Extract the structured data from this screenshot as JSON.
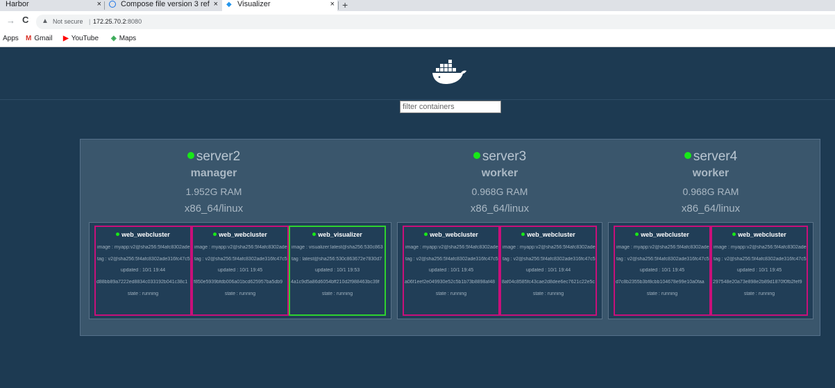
{
  "browser": {
    "tabs": [
      {
        "title": "Harbor",
        "close": "×"
      },
      {
        "title": "Compose file version 3 ref",
        "close": "×"
      },
      {
        "title": "Visualizer",
        "close": "×"
      }
    ],
    "new_tab": "+",
    "security_label": "Not secure",
    "url_host": "172.25.70.2",
    "url_port": ":8080",
    "bookmarks": [
      "Apps",
      "Gmail",
      "YouTube",
      "Maps"
    ]
  },
  "page": {
    "filter_placeholder": "filter containers"
  },
  "nodes": [
    {
      "name": "server2",
      "role": "manager",
      "ram": "1.952G RAM",
      "arch": "x86_64/linux",
      "containers": [
        {
          "name": "web_webcluster",
          "image": "image : myapp:v2@sha256:5f4afc8302ade316fc47c5",
          "tag": "tag : v2@sha256:5f4afc8302ade316fc47c5",
          "updated": "updated : 10/1 19:44",
          "id": "d88bb89a7222ed8834c033192b041c38c1",
          "state": "state : running",
          "kind": "web"
        },
        {
          "name": "web_webcluster",
          "image": "image : myapp:v2@sha256:5f4afc8302ade316fc47c5",
          "tag": "tag : v2@sha256:5f4afc8302ade316fc47c5",
          "updated": "updated : 10/1 19:45",
          "id": "f850e5939bfdb006a01bcd625957ba5db9",
          "state": "state : running",
          "kind": "web"
        },
        {
          "name": "web_visualizer",
          "image": "image : visualizer:latest@sha256:530c863",
          "tag": "tag : latest@sha256:530c863672e7830d7",
          "updated": "updated : 10/1 19:53",
          "id": "4a1c9d5a86d6054bff210d2f988463bc39f",
          "state": "state : running",
          "kind": "viz"
        }
      ]
    },
    {
      "name": "server3",
      "role": "worker",
      "ram": "0.968G RAM",
      "arch": "x86_64/linux",
      "containers": [
        {
          "name": "web_webcluster",
          "image": "image : myapp:v2@sha256:5f4afc8302ade316fc47c5",
          "tag": "tag : v2@sha256:5f4afc8302ade316fc47c5",
          "updated": "updated : 10/1 19:45",
          "id": "a06f1eef2e049930e52c5b1b73b8898af48",
          "state": "state : running",
          "kind": "web"
        },
        {
          "name": "web_webcluster",
          "image": "image : myapp:v2@sha256:5f4afc8302ade316fc47c5",
          "tag": "tag : v2@sha256:5f4afc8302ade316fc47c5",
          "updated": "updated : 10/1 19:44",
          "id": "8af04c8585fc43cae2d8dee6ec7621c22e5c",
          "state": "state : running",
          "kind": "web"
        }
      ]
    },
    {
      "name": "server4",
      "role": "worker",
      "ram": "0.968G RAM",
      "arch": "x86_64/linux",
      "containers": [
        {
          "name": "web_webcluster",
          "image": "image : myapp:v2@sha256:5f4afc8302ade316fc47c5",
          "tag": "tag : v2@sha256:5f4afc8302ade316fc47c5",
          "updated": "updated : 10/1 19:45",
          "id": "d7c8b2355b3bf8cbb104678e99e10a0faa",
          "state": "state : running",
          "kind": "web"
        },
        {
          "name": "web_webcluster",
          "image": "image : myapp:v2@sha256:5f4afc8302ade316fc47c5",
          "tag": "tag : v2@sha256:5f4afc8302ade316fc47c5",
          "updated": "updated : 10/1 19:45",
          "id": "297548e20a73e898e2b89d1870f0fb2fef9",
          "state": "state : running",
          "kind": "web"
        }
      ]
    }
  ],
  "colors": {
    "background": "#1d3a52",
    "web_container_border": "#c8107a",
    "visualizer_container_border": "#2fd12f",
    "status_dot": "#18e818"
  },
  "icons": {
    "logo": "docker-whale-icon",
    "status": "status-dot-icon"
  }
}
